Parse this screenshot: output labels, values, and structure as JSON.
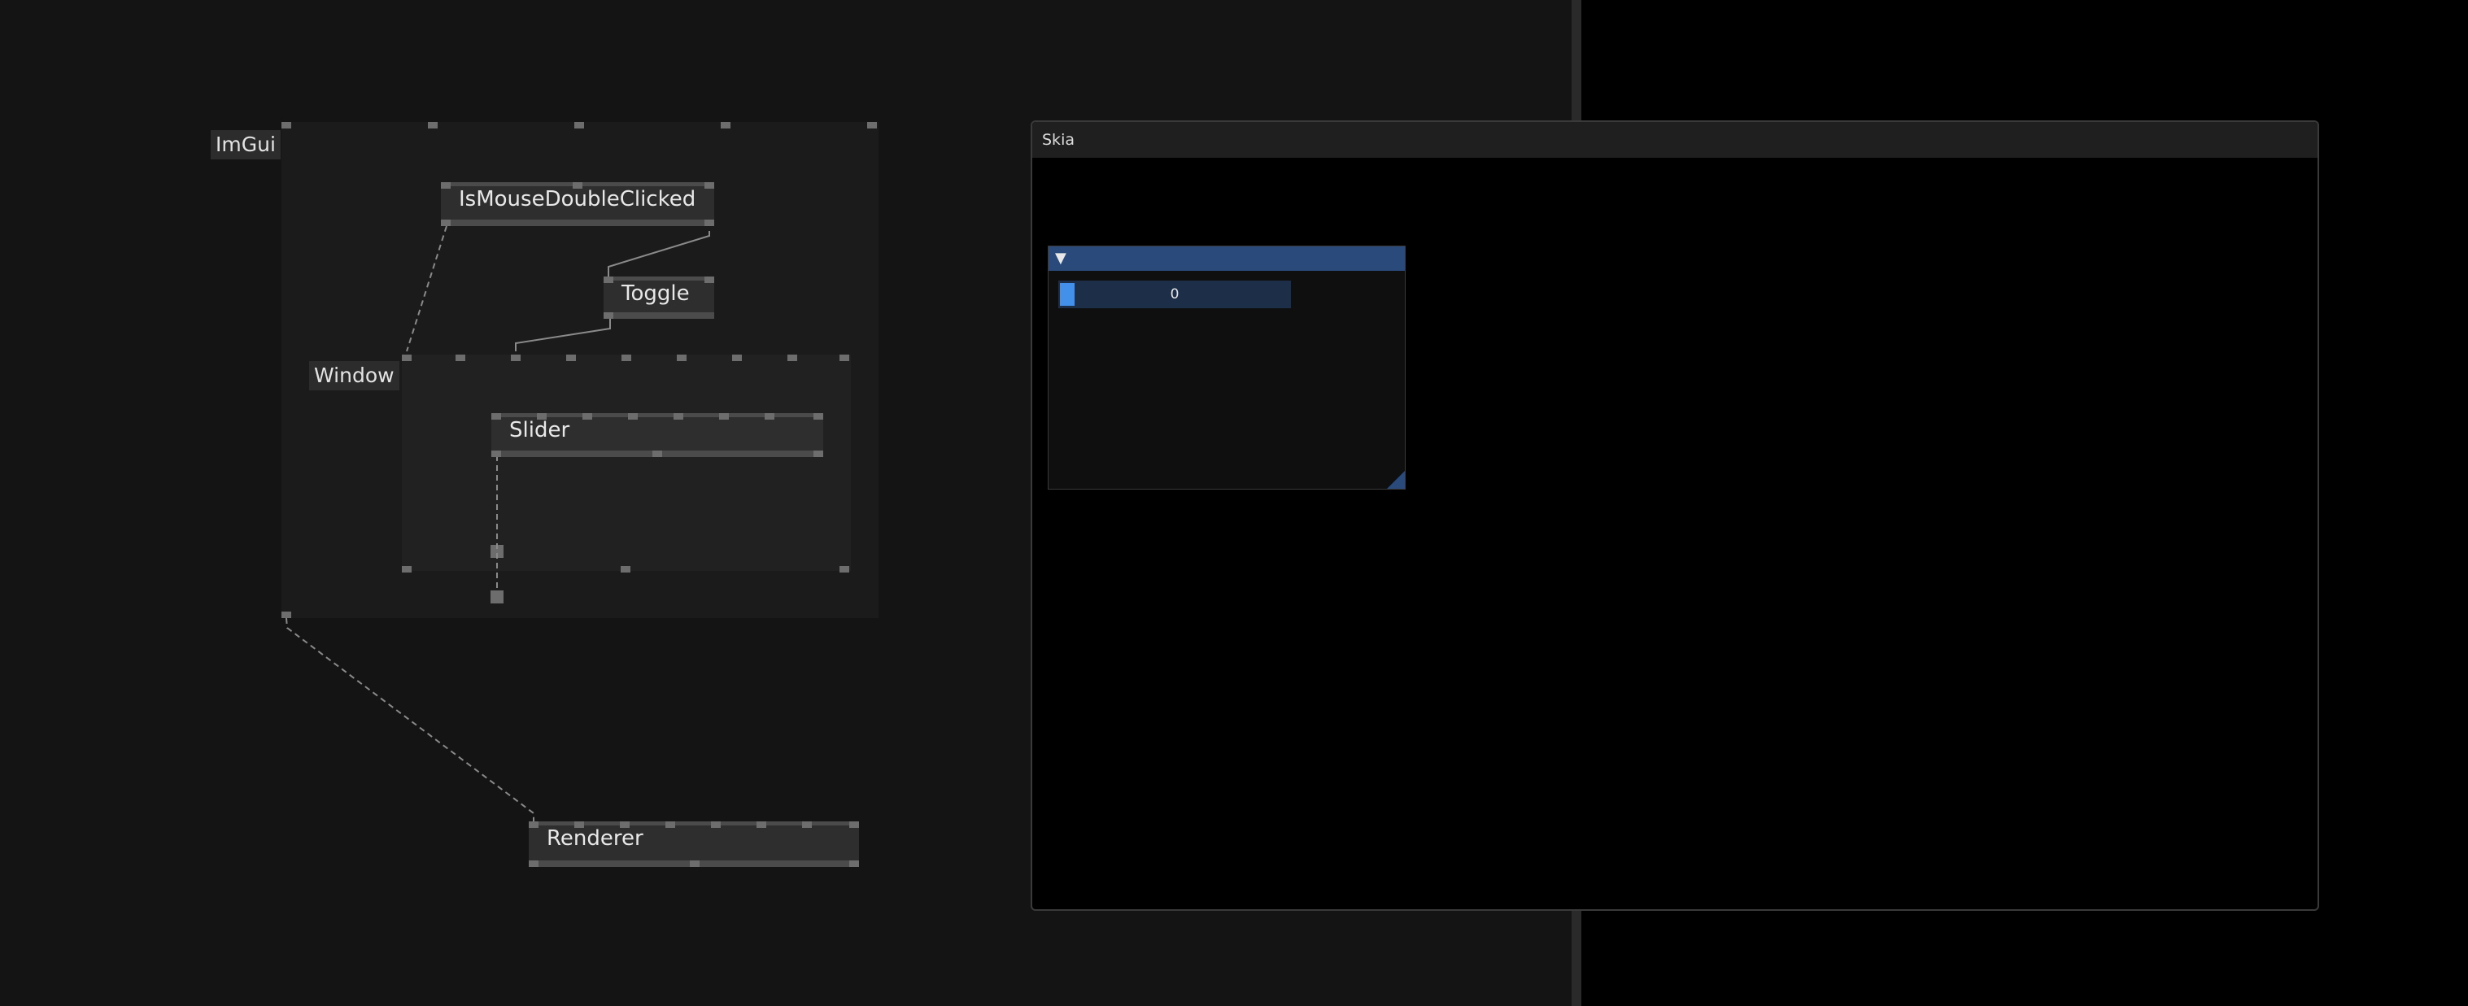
{
  "patch": {
    "imgui_region": {
      "label": "ImGui"
    },
    "window_region": {
      "label": "Window"
    },
    "nodes": {
      "is_mouse_double_clicked": "IsMouseDoubleClicked",
      "toggle": "Toggle",
      "slider": "Slider",
      "renderer": "Renderer"
    }
  },
  "skia_window": {
    "title": "Skia",
    "imgui_window": {
      "collapse_icon": "triangle-down-icon",
      "slider_value": "0"
    }
  },
  "colors": {
    "editor_bg": "#141414",
    "title_accent": "#2a4a7b",
    "slider_grab": "#4390ea",
    "slider_bg": "#1d2e48"
  }
}
